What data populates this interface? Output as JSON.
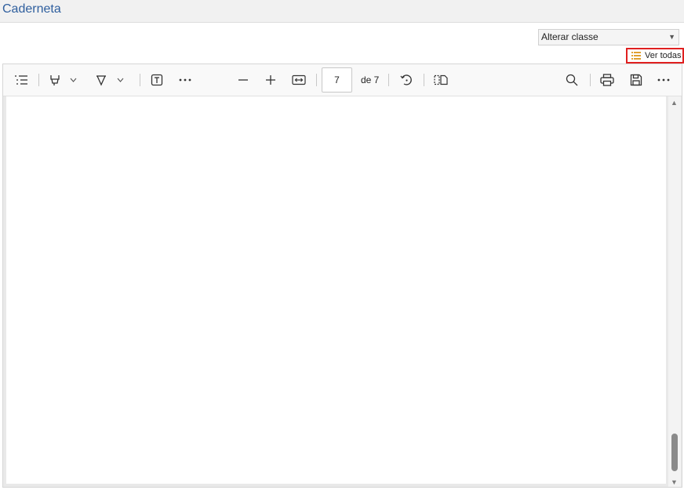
{
  "header": {
    "title": "Caderneta"
  },
  "class_select": {
    "value": "Alterar classe"
  },
  "view_all": {
    "label": "Ver todas",
    "accent": "#e0a030",
    "highlight": "#e02020"
  },
  "toolbar": {
    "icons": [
      "contents-icon",
      "highlight-icon",
      "draw-icon",
      "text-box-icon",
      "more-tools-icon",
      "zoom-out-icon",
      "zoom-in-icon",
      "fit-width-icon",
      "rotate-icon",
      "page-view-icon",
      "search-icon",
      "print-icon",
      "save-icon",
      "more-options-icon"
    ],
    "page_current": "7",
    "page_total": "de 7"
  },
  "colors": {
    "title": "#2f5f9e",
    "toolbar_bg": "#f9f9f9"
  }
}
